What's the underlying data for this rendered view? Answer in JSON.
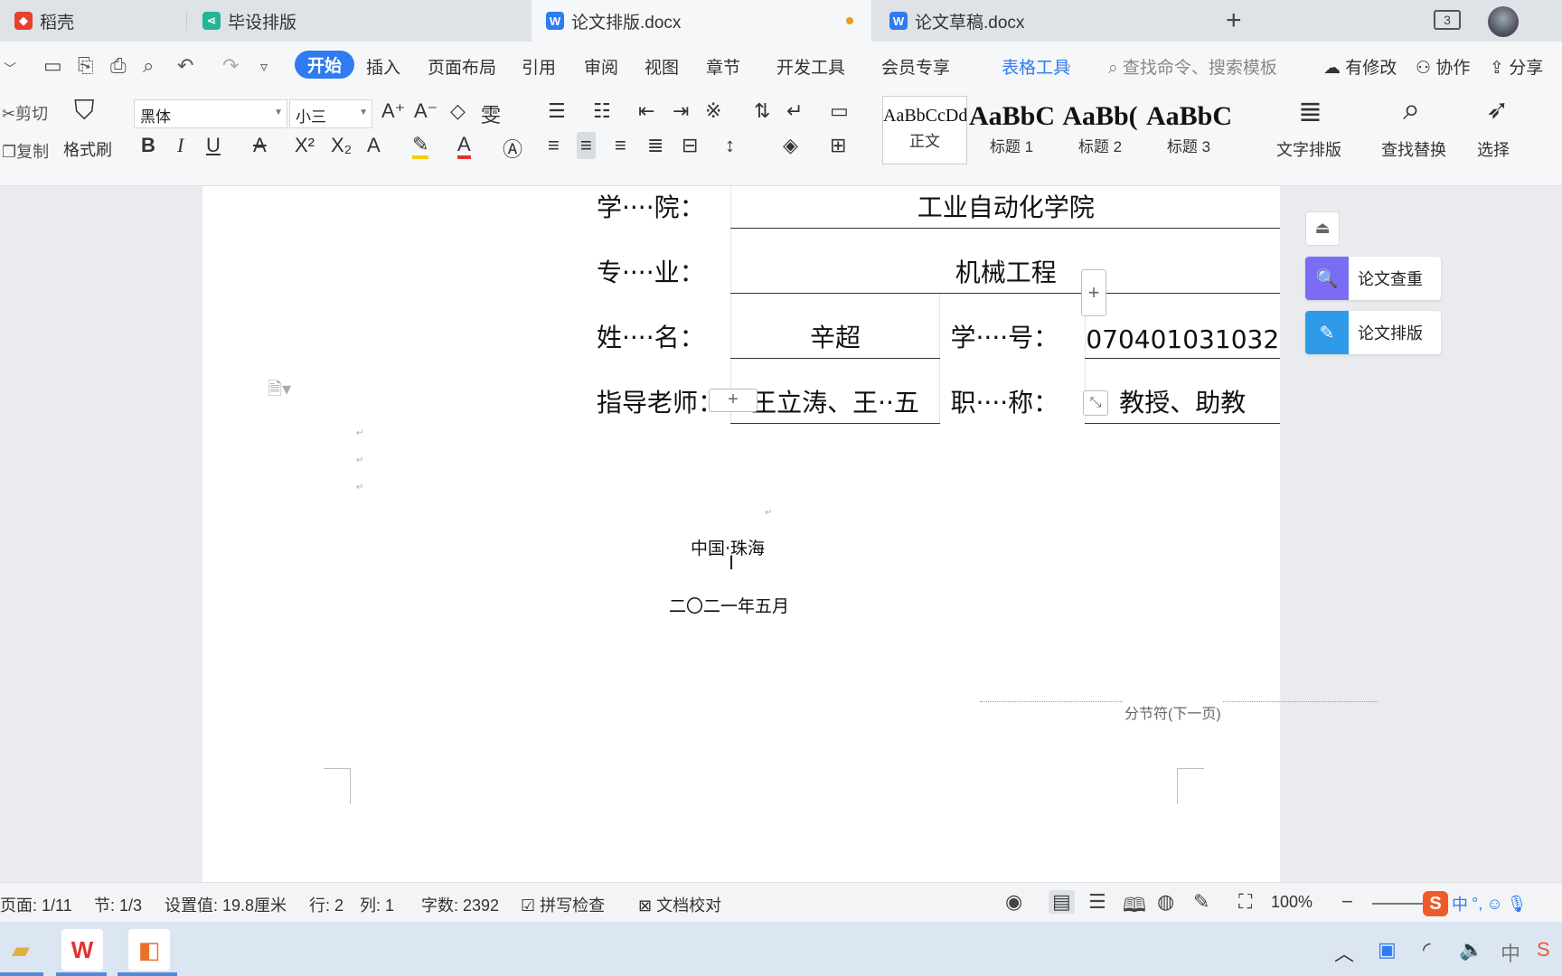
{
  "tabs": [
    {
      "label": "稻壳",
      "icon": "docer-icon",
      "icon_color": "#e8412b"
    },
    {
      "label": "毕设排版",
      "icon": "share-icon",
      "icon_color": "#22b59a"
    },
    {
      "label": "论文排版.docx",
      "icon": "word-doc-icon",
      "icon_color": "#2f7bf0",
      "active": true,
      "modified": true
    },
    {
      "label": "论文草稿.docx",
      "icon": "word-doc-icon",
      "icon_color": "#2f7bf0"
    }
  ],
  "window": {
    "tab_count": "3"
  },
  "menu": {
    "items": [
      "开始",
      "插入",
      "页面布局",
      "引用",
      "审阅",
      "视图",
      "章节",
      "开发工具",
      "会员专享",
      "表格工具"
    ],
    "search_placeholder": "查找命令、搜索模板",
    "right_actions": [
      "有修改",
      "协作",
      "分享"
    ]
  },
  "ribbon": {
    "cut": "剪切",
    "copy": "复制",
    "format_painter": "格式刷",
    "font_name": "黑体",
    "font_size": "小三",
    "styles": [
      {
        "sample": "AaBbCcDd",
        "name": "正文"
      },
      {
        "sample": "AaBbC",
        "name": "标题 1"
      },
      {
        "sample": "AaBb(",
        "name": "标题 2"
      },
      {
        "sample": "AaBbC",
        "name": "标题 3"
      }
    ],
    "text_layout": "文字排版",
    "find_replace": "查找替换",
    "select": "选择"
  },
  "document": {
    "rows": [
      {
        "label": "学····院：",
        "value": "工业自动化学院"
      },
      {
        "label": "专····业：",
        "value": "机械工程"
      },
      {
        "label": "姓····名：",
        "value": "辛超",
        "label2": "学····号：",
        "value2": "070401031032"
      },
      {
        "label": "指导老师：",
        "value": "王立涛、王··五",
        "label2": "职····称：",
        "value2": "教授、助教"
      }
    ],
    "location": "中国·珠海",
    "date": "二〇二一年五月",
    "section_break": "分节符(下一页)"
  },
  "side_panel": {
    "check": "论文查重",
    "format": "论文排版"
  },
  "status": {
    "page": "页面: 1/11",
    "section": "节: 1/3",
    "setting": "设置值: 19.8厘米",
    "row": "行: 2",
    "col": "列: 1",
    "word_count": "字数: 2392",
    "spell_check": "拼写检查",
    "doc_proof": "文档校对",
    "zoom": "100%"
  },
  "ime": {
    "lang": "中"
  },
  "colors": {
    "accent": "#2f7bf0",
    "side_check": "#7b6cf6",
    "side_format": "#2f9be8"
  }
}
